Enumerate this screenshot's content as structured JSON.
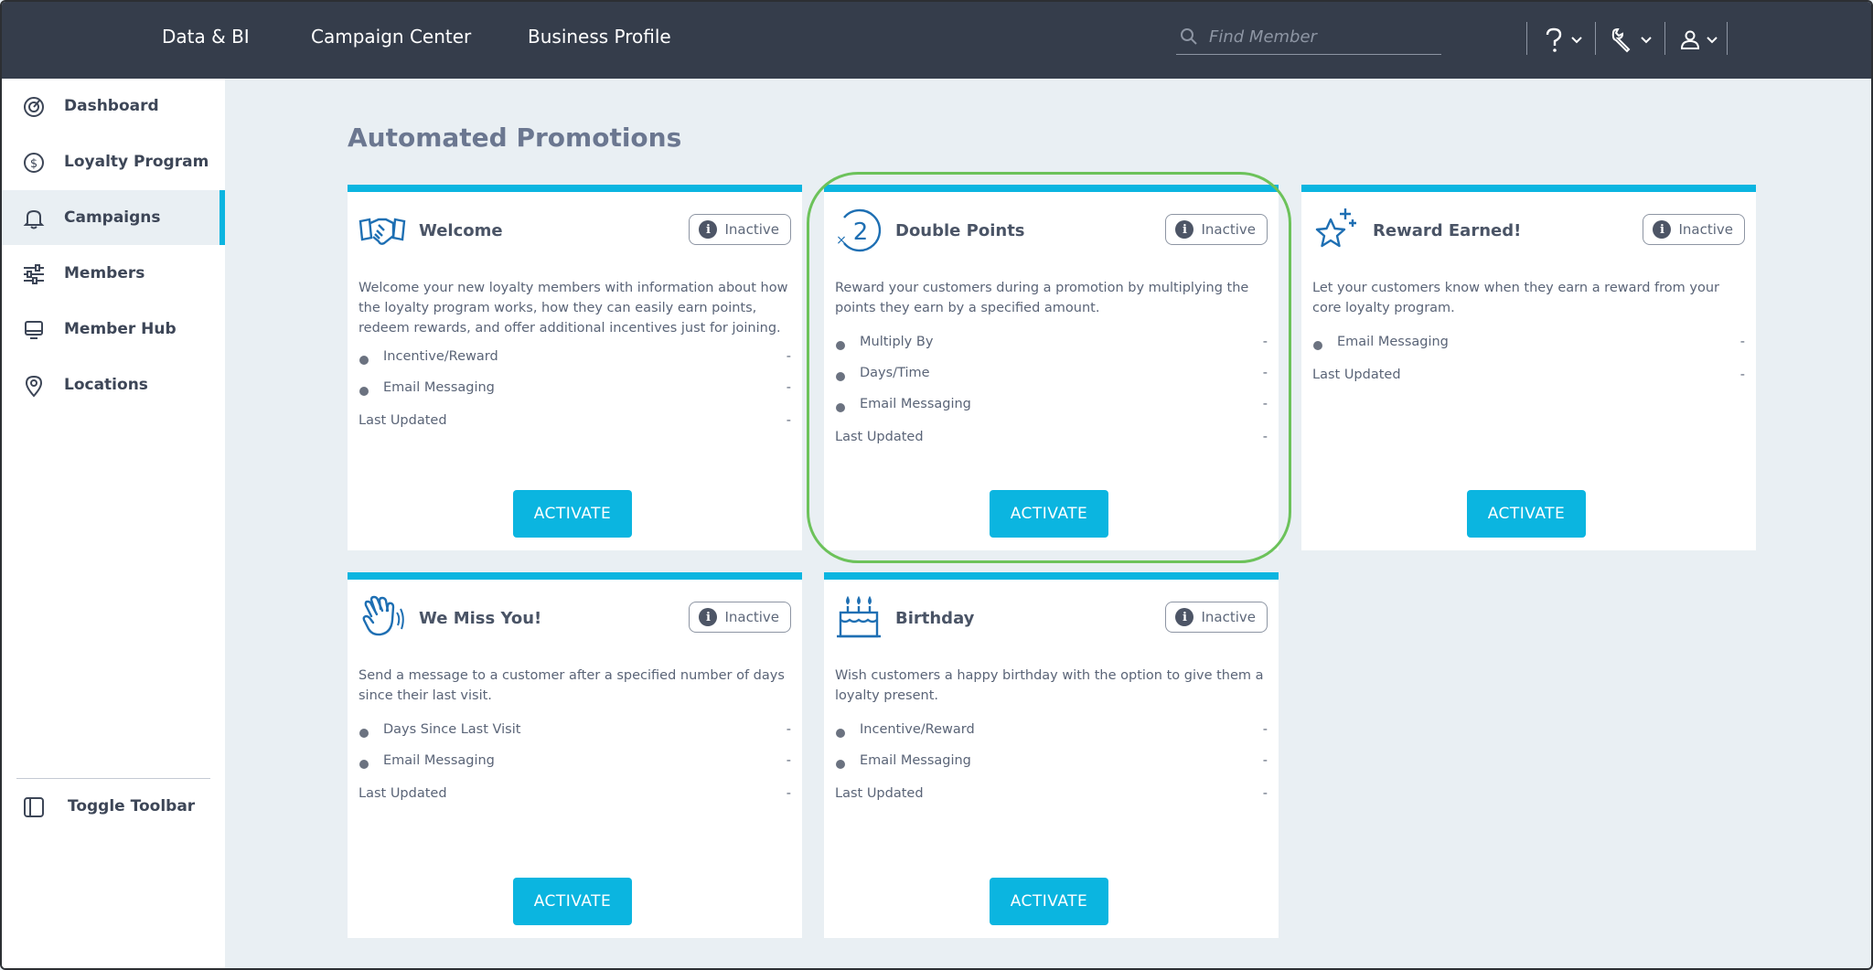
{
  "topnav": {
    "links": [
      "Data & BI",
      "Campaign Center",
      "Business Profile"
    ],
    "search_placeholder": "Find Member"
  },
  "sidebar": {
    "items": [
      {
        "label": "Dashboard",
        "icon": "gauge-icon"
      },
      {
        "label": "Loyalty Program",
        "icon": "dollar-circle-icon"
      },
      {
        "label": "Campaigns",
        "icon": "bell-icon",
        "active": true
      },
      {
        "label": "Members",
        "icon": "sliders-icon"
      },
      {
        "label": "Member Hub",
        "icon": "monitor-icon"
      },
      {
        "label": "Locations",
        "icon": "map-pin-icon"
      }
    ],
    "toggle_label": "Toggle Toolbar"
  },
  "main": {
    "title": "Automated Promotions",
    "cards": [
      {
        "title": "Welcome",
        "status": "Inactive",
        "description": "Welcome your new loyalty members with information about how the loyalty program works, how they can easily earn points, redeem rewards, and offer additional incentives just for joining.",
        "rows": [
          {
            "label": "Incentive/Reward",
            "value": "-"
          },
          {
            "label": "Email Messaging",
            "value": "-"
          }
        ],
        "last_updated_label": "Last Updated",
        "last_updated_value": "-",
        "button": "ACTIVATE"
      },
      {
        "title": "Double Points",
        "status": "Inactive",
        "description": "Reward your customers during a promotion by multiplying the points they earn by a specified amount.",
        "rows": [
          {
            "label": "Multiply By",
            "value": "-"
          },
          {
            "label": "Days/Time",
            "value": "-"
          },
          {
            "label": "Email Messaging",
            "value": "-"
          }
        ],
        "last_updated_label": "Last Updated",
        "last_updated_value": "-",
        "button": "ACTIVATE"
      },
      {
        "title": "Reward Earned!",
        "status": "Inactive",
        "description": "Let your customers know when they earn a reward from your core loyalty program.",
        "rows": [
          {
            "label": "Email Messaging",
            "value": "-"
          }
        ],
        "last_updated_label": "Last Updated",
        "last_updated_value": "-",
        "button": "ACTIVATE"
      },
      {
        "title": "We Miss You!",
        "status": "Inactive",
        "description": "Send a message to a customer after a specified number of days since their last visit.",
        "rows": [
          {
            "label": "Days Since Last Visit",
            "value": "-"
          },
          {
            "label": "Email Messaging",
            "value": "-"
          }
        ],
        "last_updated_label": "Last Updated",
        "last_updated_value": "-",
        "button": "ACTIVATE"
      },
      {
        "title": "Birthday",
        "status": "Inactive",
        "description": "Wish customers a happy birthday with the option to give them a loyalty present.",
        "rows": [
          {
            "label": "Incentive/Reward",
            "value": "-"
          },
          {
            "label": "Email Messaging",
            "value": "-"
          }
        ],
        "last_updated_label": "Last Updated",
        "last_updated_value": "-",
        "button": "ACTIVATE"
      }
    ]
  },
  "colors": {
    "nav_bg": "#353d4b",
    "accent": "#0bb5e0",
    "page_bg": "#e9eff3",
    "highlight": "#6cc25a"
  }
}
